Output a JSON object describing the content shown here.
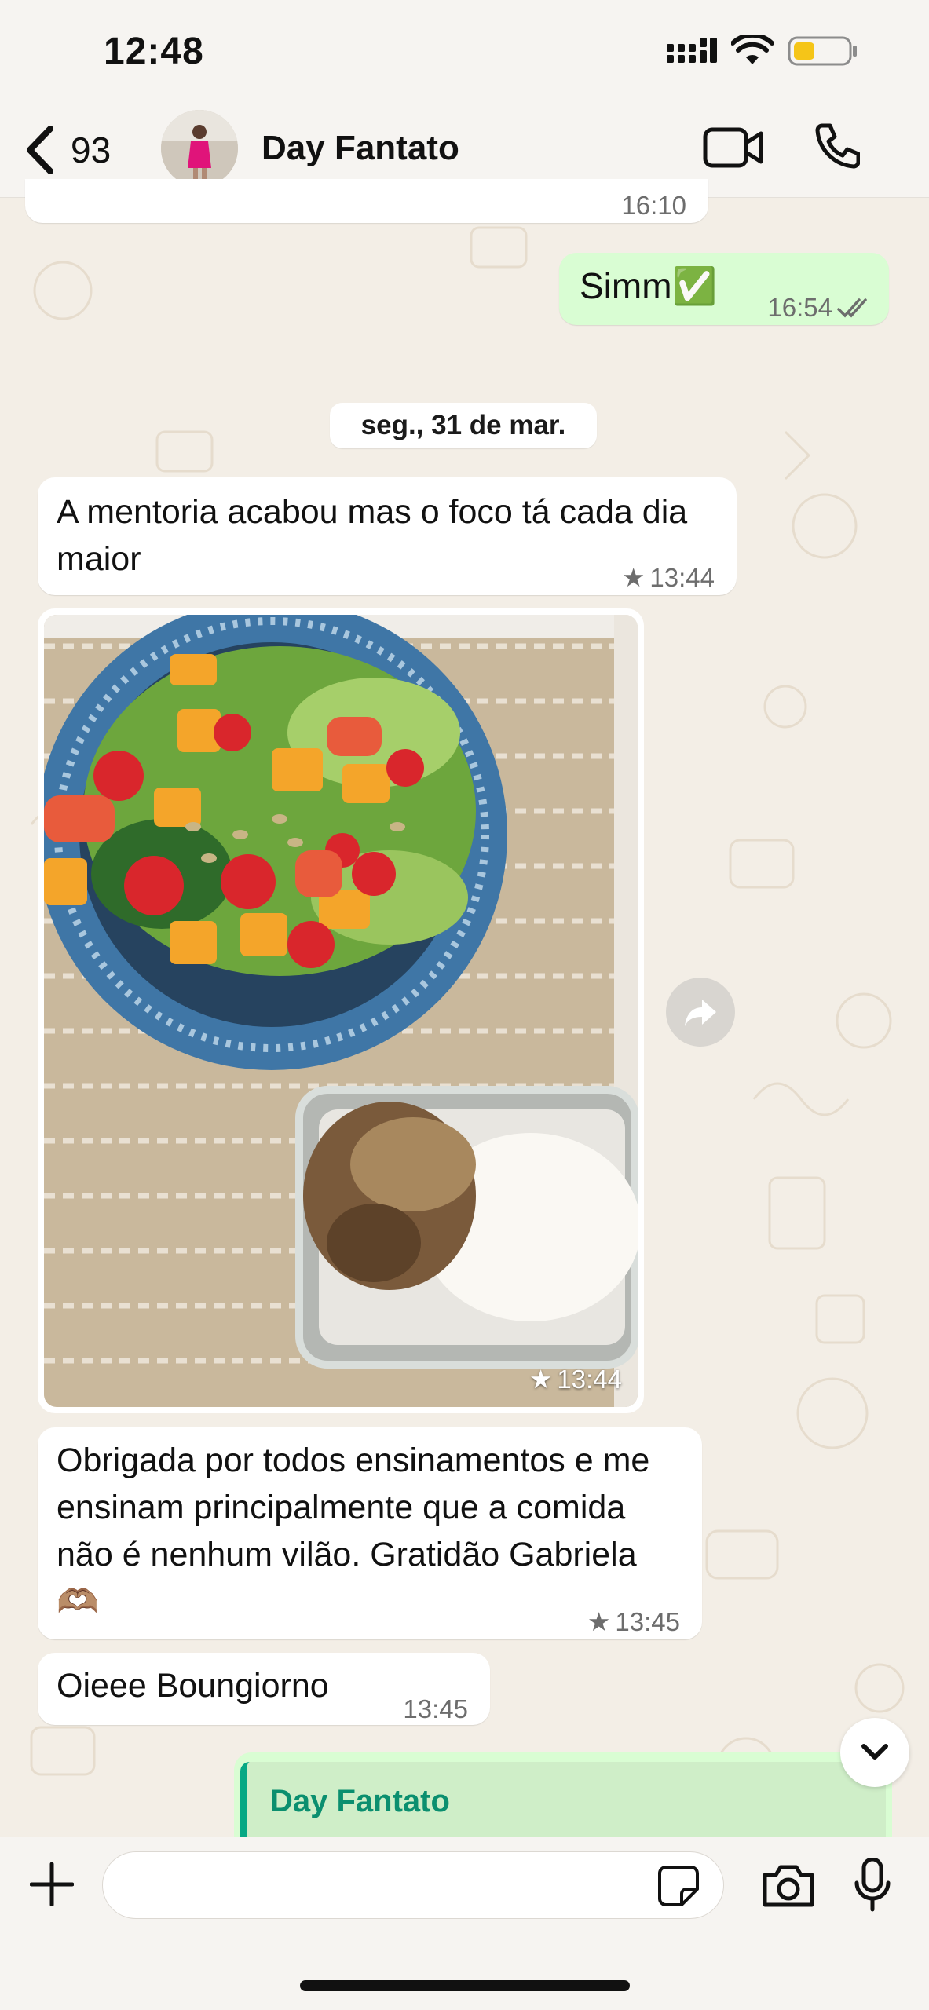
{
  "status_bar": {
    "time": "12:48"
  },
  "header": {
    "back_count": "93",
    "contact_name": "Day Fantato"
  },
  "messages": [
    {
      "time": "16:10",
      "direction": "in"
    },
    {
      "text": "Simm✅",
      "time": "16:54",
      "direction": "out",
      "read": true
    },
    {
      "text": "A mentoria acabou mas o foco tá cada dia maior",
      "time": "13:44",
      "starred": true,
      "direction": "in"
    },
    {
      "type": "image",
      "time": "13:44",
      "starred": true,
      "direction": "in"
    },
    {
      "text": "Obrigada por todos ensinamentos e me ensinam principalmente que a comida não é nenhum vilão. Gratidão Gabriela 🫶🏽",
      "time": "13:45",
      "starred": true,
      "direction": "in"
    },
    {
      "text": "Oieee Boungiorno",
      "time": "13:45",
      "direction": "in"
    }
  ],
  "date_separator": "seg., 31 de mar.",
  "quoted_reply": {
    "author": "Day Fantato"
  },
  "colors": {
    "outgoing_bubble": "#d9fdd3",
    "incoming_bubble": "#ffffff",
    "accent": "#06a884",
    "wallpaper": "#f3eee6"
  },
  "icons": [
    "back-chevron-icon",
    "video-call-icon",
    "phone-icon",
    "forward-icon",
    "chevron-down-icon",
    "plus-icon",
    "sticker-icon",
    "camera-icon",
    "mic-icon",
    "star-icon",
    "double-check-icon"
  ]
}
